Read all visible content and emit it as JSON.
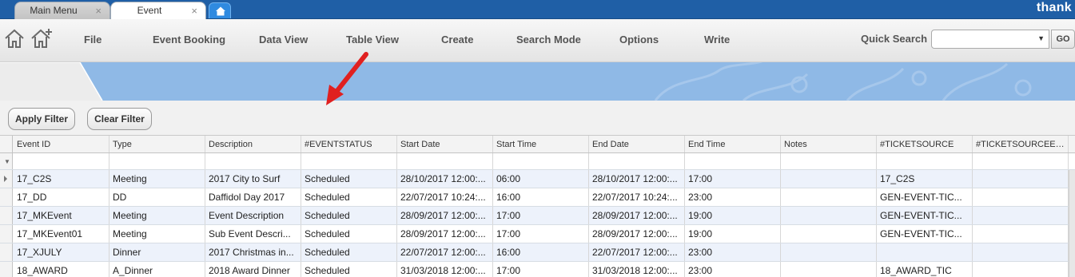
{
  "tabs": [
    {
      "label": "Main Menu",
      "close": "×"
    },
    {
      "label": "Event",
      "close": "×"
    }
  ],
  "brand": "thank",
  "menu": {
    "items": [
      "File",
      "Event Booking",
      "Data View",
      "Table View",
      "Create",
      "Search Mode",
      "Options",
      "Write"
    ],
    "quick_search_label": "Quick Search",
    "quick_search_value": "",
    "go_label": "GO"
  },
  "filter_bar": {
    "apply_label": "Apply Filter",
    "clear_label": "Clear Filter"
  },
  "grid": {
    "columns": [
      "Event ID",
      "Type",
      "Description",
      "#EVENTSTATUS",
      "Start Date",
      "Start Time",
      "End Date",
      "End Time",
      "Notes",
      "#TICKETSOURCE",
      "#TICKETSOURCEEXGST"
    ],
    "rows": [
      [
        "17_C2S",
        "Meeting",
        "2017 City to Surf",
        "Scheduled",
        "28/10/2017 12:00:...",
        "06:00",
        "28/10/2017 12:00:...",
        "17:00",
        "",
        "17_C2S",
        ""
      ],
      [
        "17_DD",
        "DD",
        "Daffidol Day 2017",
        "Scheduled",
        "22/07/2017 10:24:...",
        "16:00",
        "22/07/2017 10:24:...",
        "23:00",
        "",
        "GEN-EVENT-TIC...",
        ""
      ],
      [
        "17_MKEvent",
        "Meeting",
        "Event Description",
        "Scheduled",
        "28/09/2017 12:00:...",
        "17:00",
        "28/09/2017 12:00:...",
        "19:00",
        "",
        "GEN-EVENT-TIC...",
        ""
      ],
      [
        "17_MKEvent01",
        "Meeting",
        "Sub Event Descri...",
        "Scheduled",
        "28/09/2017 12:00:...",
        "17:00",
        "28/09/2017 12:00:...",
        "19:00",
        "",
        "GEN-EVENT-TIC...",
        ""
      ],
      [
        "17_XJULY",
        "Dinner",
        "2017 Christmas in...",
        "Scheduled",
        "22/07/2017 12:00:...",
        "16:00",
        "22/07/2017 12:00:...",
        "23:00",
        "",
        "",
        ""
      ],
      [
        "18_AWARD",
        "A_Dinner",
        "2018 Award Dinner",
        "Scheduled",
        "31/03/2018 12:00:...",
        "17:00",
        "31/03/2018 12:00:...",
        "23:00",
        "",
        "18_AWARD_TIC",
        ""
      ]
    ]
  },
  "colors": {
    "tabbar": "#1f5fa6",
    "banner": "#8fb9e6",
    "arrow": "#e02020",
    "alt_row": "#edf2fb"
  },
  "icons": [
    "home-icon",
    "add-home-icon",
    "home-tab-icon",
    "close-icon",
    "dropdown-arrow-icon",
    "filter-funnel-icon",
    "row-pointer-icon"
  ]
}
